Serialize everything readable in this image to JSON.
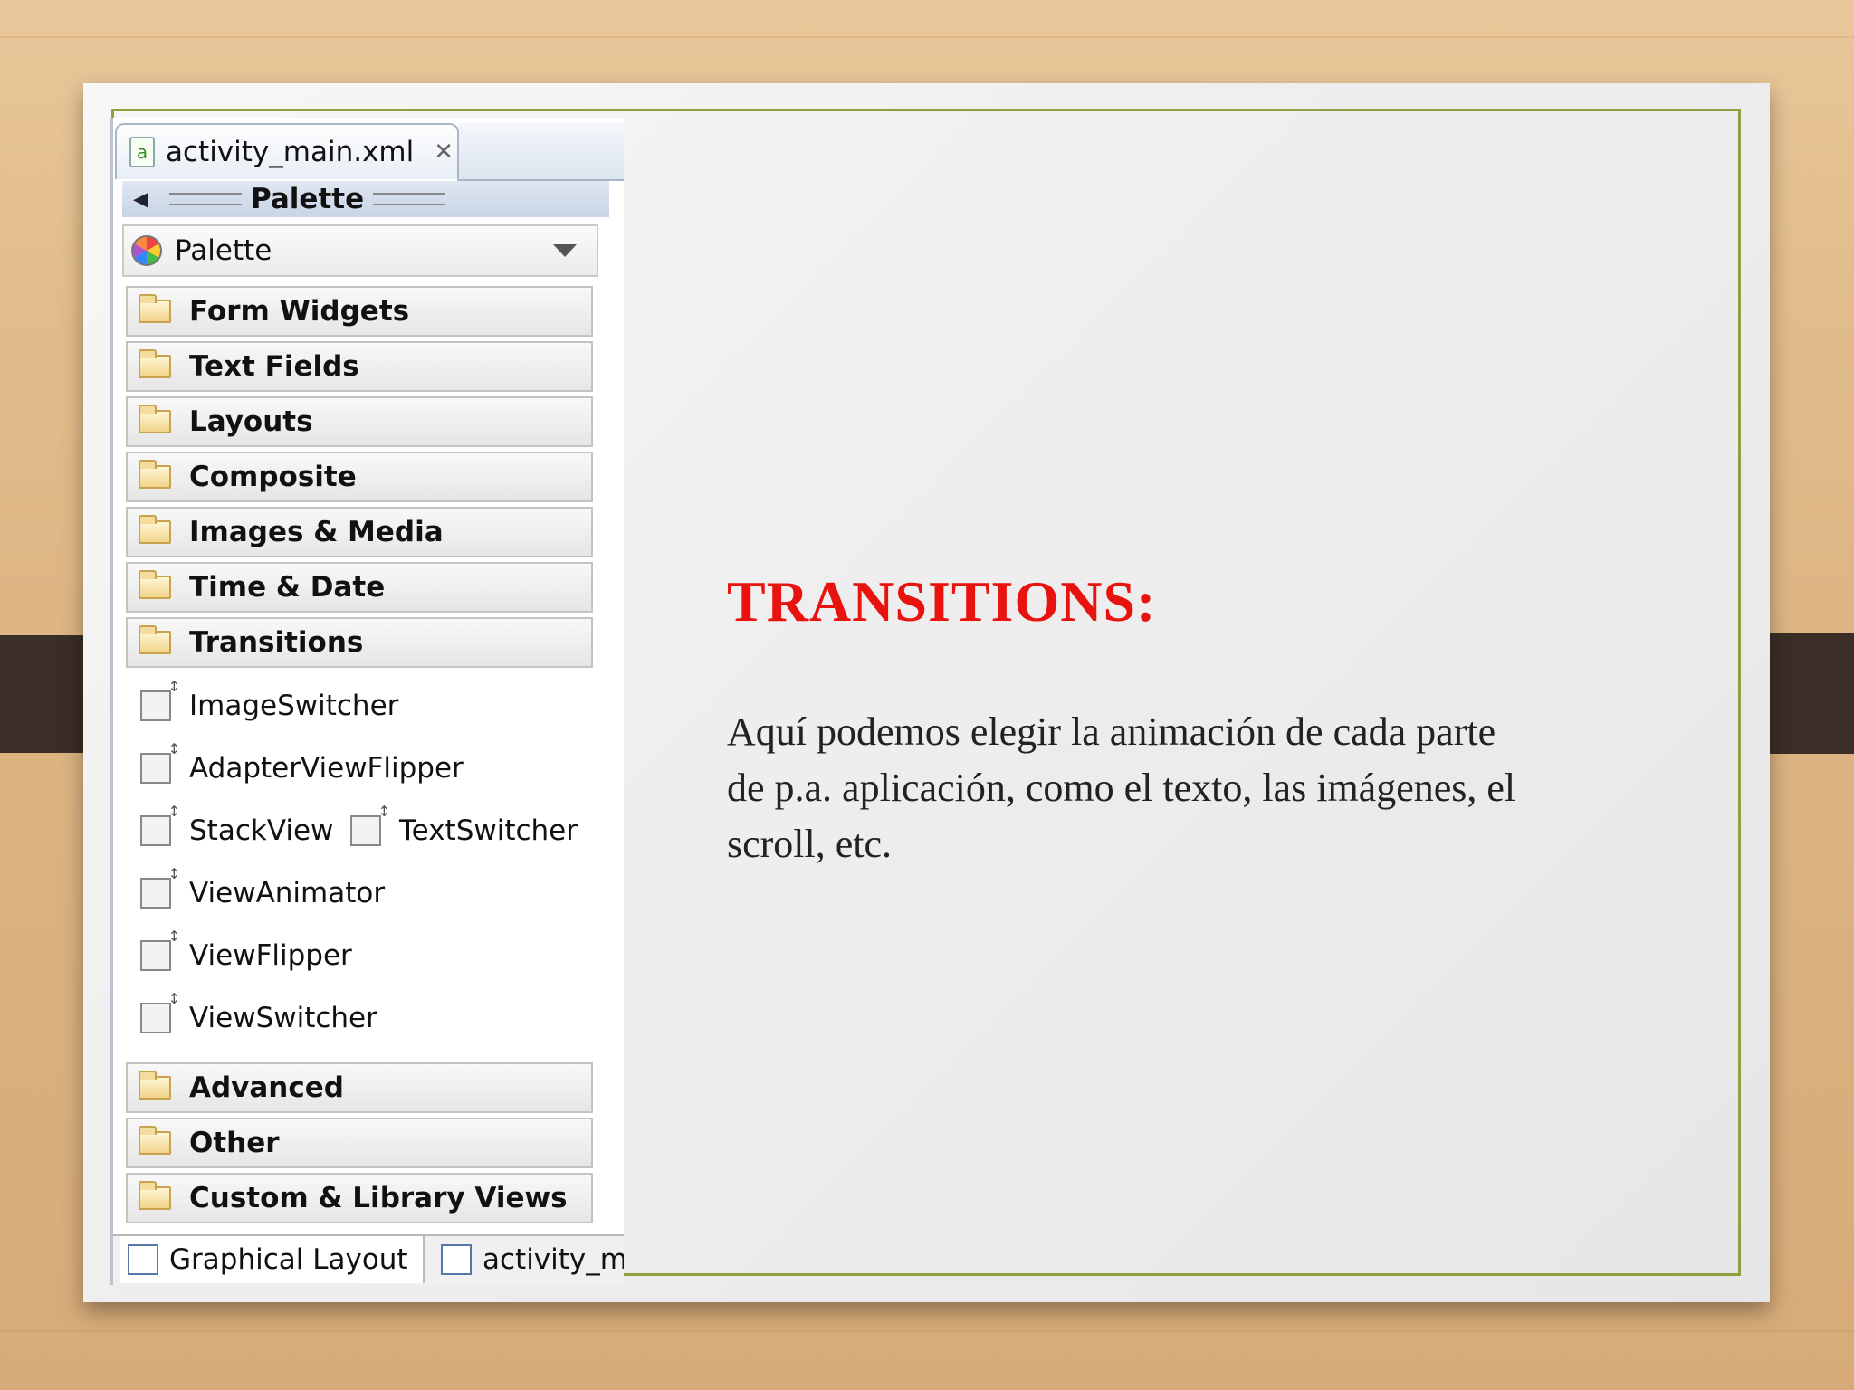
{
  "editor": {
    "file_tab": "activity_main.xml",
    "palette_header": "Palette",
    "palette_select": "Palette",
    "categories": [
      "Form Widgets",
      "Text Fields",
      "Layouts",
      "Composite",
      "Images & Media",
      "Time & Date",
      "Transitions",
      "Advanced",
      "Other",
      "Custom & Library Views"
    ],
    "transition_items": [
      "ImageSwitcher",
      "AdapterViewFlipper",
      "StackView",
      "TextSwitcher",
      "ViewAnimator",
      "ViewFlipper",
      "ViewSwitcher"
    ],
    "bottom_tabs": [
      "Graphical Layout",
      "activity_ma"
    ]
  },
  "slide": {
    "heading": "TRANSITIONS:",
    "body": "Aquí podemos elegir la animación de cada parte de p.a. aplicación, como el texto, las imágenes, el scroll, etc.",
    "heading_color": "#e8120e"
  }
}
